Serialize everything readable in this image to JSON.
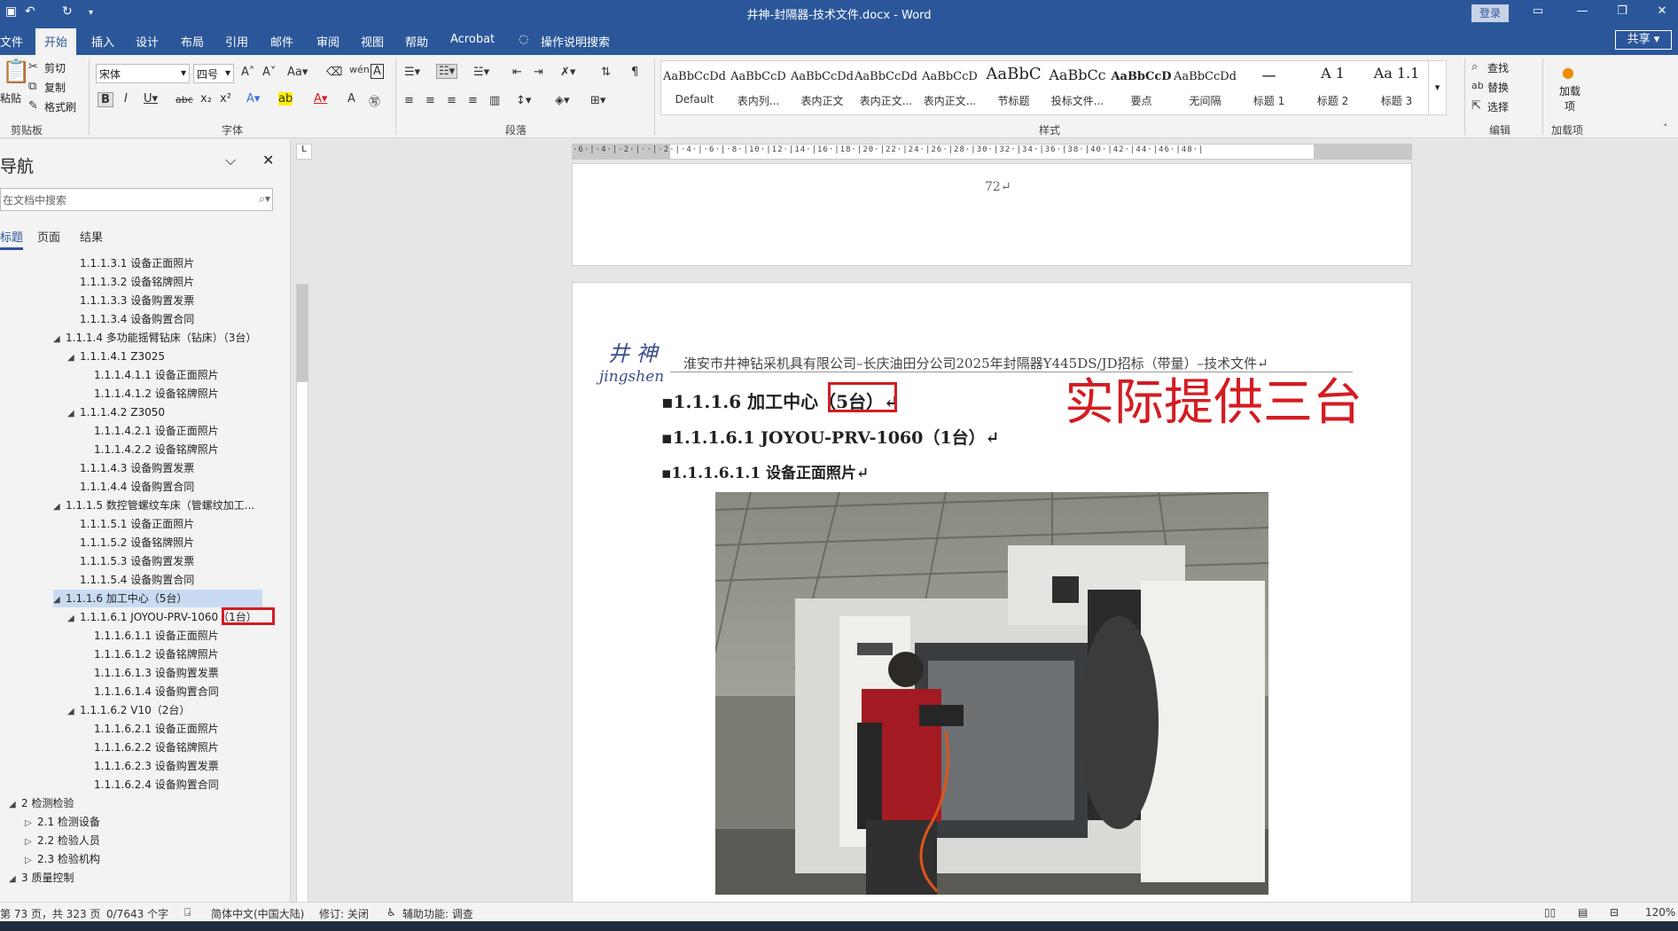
{
  "window": {
    "title": "井神-封隔器-技术文件.docx  -  Word",
    "login_label": "登录",
    "share_label": "共享"
  },
  "menu": {
    "tabs": [
      "文件",
      "开始",
      "插入",
      "设计",
      "布局",
      "引用",
      "邮件",
      "审阅",
      "视图",
      "帮助",
      "Acrobat"
    ],
    "search_label": "操作说明搜索"
  },
  "ribbon": {
    "clipboard": {
      "paste": "粘贴",
      "cut": "剪切",
      "copy": "复制",
      "format_painter": "格式刷",
      "label": "剪贴板"
    },
    "font": {
      "name": "宋体",
      "size": "四号",
      "label": "字体"
    },
    "paragraph": {
      "label": "段落"
    },
    "styles": {
      "label": "样式",
      "items": [
        {
          "sample": "AaBbCcDd",
          "name": "Default"
        },
        {
          "sample": "AaBbCcD",
          "name": "表内列..."
        },
        {
          "sample": "AaBbCcDdI",
          "name": "表内正文"
        },
        {
          "sample": "AaBbCcDdI",
          "name": "表内正文..."
        },
        {
          "sample": "AaBbCcD",
          "name": "表内正文..."
        },
        {
          "sample": "AaBbC",
          "name": "节标题"
        },
        {
          "sample": "AaBbCc",
          "name": "投标文件..."
        },
        {
          "sample": "AaBbCcD",
          "name": "要点"
        },
        {
          "sample": "AaBbCcDdI",
          "name": "无间隔"
        },
        {
          "sample": "一",
          "name": "标题 1"
        },
        {
          "sample": "A 1",
          "name": "标题 2"
        },
        {
          "sample": "Aa 1.1",
          "name": "标题 3"
        }
      ]
    },
    "editing": {
      "find": "查找",
      "replace": "替换",
      "select": "选择",
      "label": "编辑"
    },
    "addins": {
      "name": "加载项",
      "label": "加载项"
    }
  },
  "nav": {
    "title": "导航",
    "search_placeholder": "在文档中搜索",
    "tabs": [
      "标题",
      "页面",
      "结果"
    ],
    "items": [
      {
        "text": "1.1.1.3.1 设备正面照片",
        "level": 4,
        "tri": ""
      },
      {
        "text": "1.1.1.3.2 设备铭牌照片",
        "level": 4,
        "tri": ""
      },
      {
        "text": "1.1.1.3.3 设备购置发票",
        "level": 4,
        "tri": ""
      },
      {
        "text": "1.1.1.3.4 设备购置合同",
        "level": 4,
        "tri": ""
      },
      {
        "text": "1.1.1.4 多功能摇臂钻床（钻床）（3台）",
        "level": 3,
        "tri": "◢"
      },
      {
        "text": "1.1.1.4.1 Z3025",
        "level": 4,
        "tri": "◢"
      },
      {
        "text": "1.1.1.4.1.1 设备正面照片",
        "level": 5,
        "tri": ""
      },
      {
        "text": "1.1.1.4.1.2 设备铭牌照片",
        "level": 5,
        "tri": ""
      },
      {
        "text": "1.1.1.4.2 Z3050",
        "level": 4,
        "tri": "◢"
      },
      {
        "text": "1.1.1.4.2.1 设备正面照片",
        "level": 5,
        "tri": ""
      },
      {
        "text": "1.1.1.4.2.2 设备铭牌照片",
        "level": 5,
        "tri": ""
      },
      {
        "text": "1.1.1.4.3 设备购置发票",
        "level": 4,
        "tri": ""
      },
      {
        "text": "1.1.1.4.4 设备购置合同",
        "level": 4,
        "tri": ""
      },
      {
        "text": "1.1.1.5 数控管螺纹车床（管螺纹加工...",
        "level": 3,
        "tri": "◢"
      },
      {
        "text": "1.1.1.5.1 设备正面照片",
        "level": 4,
        "tri": ""
      },
      {
        "text": "1.1.1.5.2 设备铭牌照片",
        "level": 4,
        "tri": ""
      },
      {
        "text": "1.1.1.5.3 设备购置发票",
        "level": 4,
        "tri": ""
      },
      {
        "text": "1.1.1.5.4 设备购置合同",
        "level": 4,
        "tri": ""
      },
      {
        "text": "1.1.1.6 加工中心（5台）",
        "level": 3,
        "tri": "◢",
        "selected": true
      },
      {
        "text": "1.1.1.6.1 JOYOU-PRV-1060（1台）",
        "level": 4,
        "tri": "◢"
      },
      {
        "text": "1.1.1.6.1.1 设备正面照片",
        "level": 5,
        "tri": ""
      },
      {
        "text": "1.1.1.6.1.2 设备铭牌照片",
        "level": 5,
        "tri": ""
      },
      {
        "text": "1.1.1.6.1.3 设备购置发票",
        "level": 5,
        "tri": ""
      },
      {
        "text": "1.1.1.6.1.4 设备购置合同",
        "level": 5,
        "tri": ""
      },
      {
        "text": "1.1.1.6.2 V10（2台）",
        "level": 4,
        "tri": "◢"
      },
      {
        "text": "1.1.1.6.2.1 设备正面照片",
        "level": 5,
        "tri": ""
      },
      {
        "text": "1.1.1.6.2.2 设备铭牌照片",
        "level": 5,
        "tri": ""
      },
      {
        "text": "1.1.1.6.2.3 设备购置发票",
        "level": 5,
        "tri": ""
      },
      {
        "text": "1.1.1.6.2.4 设备购置合同",
        "level": 5,
        "tri": ""
      },
      {
        "text": "2 检测检验",
        "level": 1,
        "tri": "◢"
      },
      {
        "text": "2.1 检测设备",
        "level": 2,
        "tri": "▷"
      },
      {
        "text": "2.2 检验人员",
        "level": 2,
        "tri": "▷"
      },
      {
        "text": "2.3 检验机构",
        "level": 2,
        "tri": "▷"
      },
      {
        "text": "3 质量控制",
        "level": 1,
        "tri": "◢"
      }
    ]
  },
  "document": {
    "page_number": "72↵",
    "logo_cn": "井 神",
    "logo_en": "jingshen",
    "header": "淮安市井神钻采机具有限公司–长庆油田分公司2025年封隔器Y445DS/JD招标（带量）–技术文件↵",
    "heading1": "▪1.1.1.6 加工中心（5台）↵",
    "heading2": "▪1.1.1.6.1 JOYOU-PRV-1060（1台）↵",
    "heading3": "▪1.1.1.6.1.1 设备正面照片↵",
    "annotation": "实际提供三台"
  },
  "status": {
    "page": "第 73 页，共 323 页",
    "words": "0/7643 个字",
    "language": "简体中文(中国大陆)",
    "track": "修订: 关闭",
    "accessibility": "辅助功能: 调查",
    "zoom": "120%"
  },
  "colors": {
    "accent": "#2b579a",
    "annotation": "#d41c22"
  }
}
